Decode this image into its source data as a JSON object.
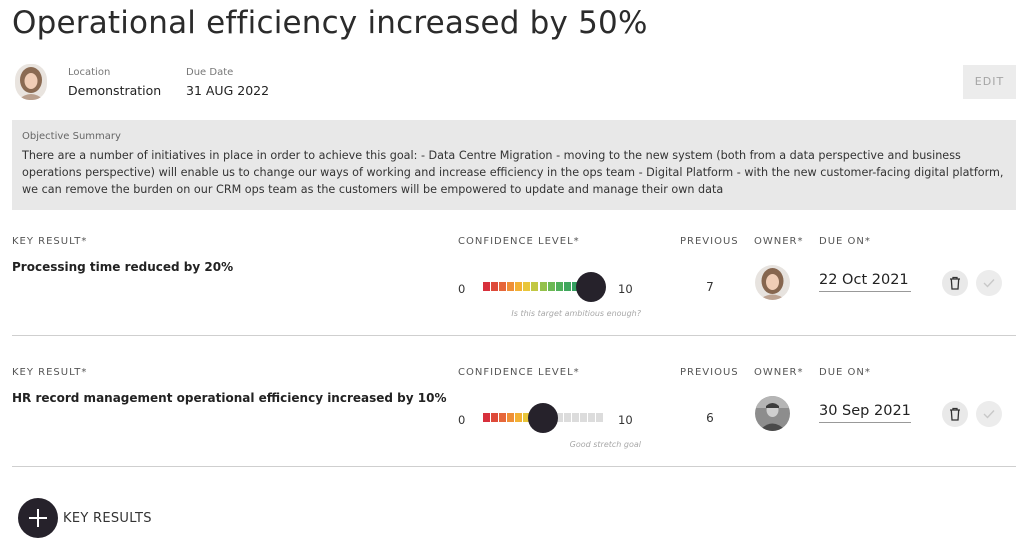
{
  "objective": {
    "title": "Operational efficiency increased by 50%",
    "location_label": "Location",
    "location_value": "Demonstration",
    "due_label": "Due Date",
    "due_value": "31 AUG 2022",
    "edit_label": "EDIT"
  },
  "summary": {
    "label": "Objective Summary",
    "text": "There are a number of initiatives in place in order to achieve this goal: - Data Centre Migration - moving to the new system (both from a data perspective and business operations perspective) will enable us to change our ways of working and increase efficiency in the ops team - Digital Platform - with the new customer-facing digital platform, we can remove the burden on our CRM ops team as the customers will be empowered to update and manage their own data"
  },
  "columns": {
    "key_result": "KEY RESULT*",
    "confidence": "CONFIDENCE LEVEL*",
    "previous": "PREVIOUS",
    "owner": "OWNER*",
    "due_on": "DUE ON*"
  },
  "key_results": [
    {
      "text": "Processing time reduced by 20%",
      "scale_min": "0",
      "scale_max": "10",
      "confidence": 9,
      "hint": "Is this target ambitious enough?",
      "previous": "7",
      "due_on": "22 Oct 2021",
      "owner_icon": "female-avatar"
    },
    {
      "text": "HR record management operational efficiency increased by 10%",
      "scale_min": "0",
      "scale_max": "10",
      "confidence": 5,
      "hint": "Good stretch goal",
      "previous": "6",
      "due_on": "30 Sep 2021",
      "owner_icon": "male-avatar-bw"
    }
  ],
  "add_button": {
    "label": "KEY RESULTS",
    "icon": "plus-icon"
  },
  "colors": {
    "accent_dark": "#26222b",
    "scale": [
      "#d7303c",
      "#de4a3a",
      "#e6673a",
      "#ef8f36",
      "#f3b134",
      "#e9c63a",
      "#c2c843",
      "#94c14b",
      "#6bb954",
      "#4fb05a",
      "#3fa75d",
      "#35a060",
      "#2e9a62",
      "#2a9563",
      "#279164"
    ],
    "scale_off": "#dcdcdc"
  }
}
